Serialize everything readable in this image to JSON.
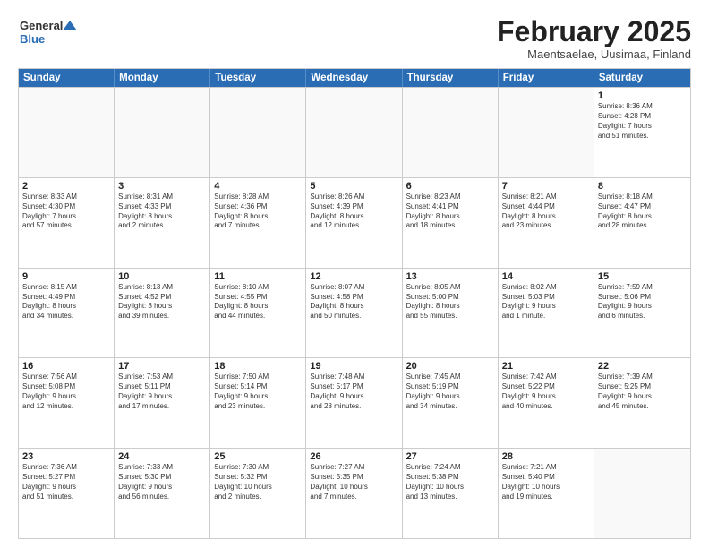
{
  "logo": {
    "general": "General",
    "blue": "Blue"
  },
  "title": "February 2025",
  "location": "Maentsaelae, Uusimaa, Finland",
  "days_of_week": [
    "Sunday",
    "Monday",
    "Tuesday",
    "Wednesday",
    "Thursday",
    "Friday",
    "Saturday"
  ],
  "rows": [
    [
      {
        "day": "",
        "text": ""
      },
      {
        "day": "",
        "text": ""
      },
      {
        "day": "",
        "text": ""
      },
      {
        "day": "",
        "text": ""
      },
      {
        "day": "",
        "text": ""
      },
      {
        "day": "",
        "text": ""
      },
      {
        "day": "1",
        "text": "Sunrise: 8:36 AM\nSunset: 4:28 PM\nDaylight: 7 hours\nand 51 minutes."
      }
    ],
    [
      {
        "day": "2",
        "text": "Sunrise: 8:33 AM\nSunset: 4:30 PM\nDaylight: 7 hours\nand 57 minutes."
      },
      {
        "day": "3",
        "text": "Sunrise: 8:31 AM\nSunset: 4:33 PM\nDaylight: 8 hours\nand 2 minutes."
      },
      {
        "day": "4",
        "text": "Sunrise: 8:28 AM\nSunset: 4:36 PM\nDaylight: 8 hours\nand 7 minutes."
      },
      {
        "day": "5",
        "text": "Sunrise: 8:26 AM\nSunset: 4:39 PM\nDaylight: 8 hours\nand 12 minutes."
      },
      {
        "day": "6",
        "text": "Sunrise: 8:23 AM\nSunset: 4:41 PM\nDaylight: 8 hours\nand 18 minutes."
      },
      {
        "day": "7",
        "text": "Sunrise: 8:21 AM\nSunset: 4:44 PM\nDaylight: 8 hours\nand 23 minutes."
      },
      {
        "day": "8",
        "text": "Sunrise: 8:18 AM\nSunset: 4:47 PM\nDaylight: 8 hours\nand 28 minutes."
      }
    ],
    [
      {
        "day": "9",
        "text": "Sunrise: 8:15 AM\nSunset: 4:49 PM\nDaylight: 8 hours\nand 34 minutes."
      },
      {
        "day": "10",
        "text": "Sunrise: 8:13 AM\nSunset: 4:52 PM\nDaylight: 8 hours\nand 39 minutes."
      },
      {
        "day": "11",
        "text": "Sunrise: 8:10 AM\nSunset: 4:55 PM\nDaylight: 8 hours\nand 44 minutes."
      },
      {
        "day": "12",
        "text": "Sunrise: 8:07 AM\nSunset: 4:58 PM\nDaylight: 8 hours\nand 50 minutes."
      },
      {
        "day": "13",
        "text": "Sunrise: 8:05 AM\nSunset: 5:00 PM\nDaylight: 8 hours\nand 55 minutes."
      },
      {
        "day": "14",
        "text": "Sunrise: 8:02 AM\nSunset: 5:03 PM\nDaylight: 9 hours\nand 1 minute."
      },
      {
        "day": "15",
        "text": "Sunrise: 7:59 AM\nSunset: 5:06 PM\nDaylight: 9 hours\nand 6 minutes."
      }
    ],
    [
      {
        "day": "16",
        "text": "Sunrise: 7:56 AM\nSunset: 5:08 PM\nDaylight: 9 hours\nand 12 minutes."
      },
      {
        "day": "17",
        "text": "Sunrise: 7:53 AM\nSunset: 5:11 PM\nDaylight: 9 hours\nand 17 minutes."
      },
      {
        "day": "18",
        "text": "Sunrise: 7:50 AM\nSunset: 5:14 PM\nDaylight: 9 hours\nand 23 minutes."
      },
      {
        "day": "19",
        "text": "Sunrise: 7:48 AM\nSunset: 5:17 PM\nDaylight: 9 hours\nand 28 minutes."
      },
      {
        "day": "20",
        "text": "Sunrise: 7:45 AM\nSunset: 5:19 PM\nDaylight: 9 hours\nand 34 minutes."
      },
      {
        "day": "21",
        "text": "Sunrise: 7:42 AM\nSunset: 5:22 PM\nDaylight: 9 hours\nand 40 minutes."
      },
      {
        "day": "22",
        "text": "Sunrise: 7:39 AM\nSunset: 5:25 PM\nDaylight: 9 hours\nand 45 minutes."
      }
    ],
    [
      {
        "day": "23",
        "text": "Sunrise: 7:36 AM\nSunset: 5:27 PM\nDaylight: 9 hours\nand 51 minutes."
      },
      {
        "day": "24",
        "text": "Sunrise: 7:33 AM\nSunset: 5:30 PM\nDaylight: 9 hours\nand 56 minutes."
      },
      {
        "day": "25",
        "text": "Sunrise: 7:30 AM\nSunset: 5:32 PM\nDaylight: 10 hours\nand 2 minutes."
      },
      {
        "day": "26",
        "text": "Sunrise: 7:27 AM\nSunset: 5:35 PM\nDaylight: 10 hours\nand 7 minutes."
      },
      {
        "day": "27",
        "text": "Sunrise: 7:24 AM\nSunset: 5:38 PM\nDaylight: 10 hours\nand 13 minutes."
      },
      {
        "day": "28",
        "text": "Sunrise: 7:21 AM\nSunset: 5:40 PM\nDaylight: 10 hours\nand 19 minutes."
      },
      {
        "day": "",
        "text": ""
      }
    ]
  ]
}
